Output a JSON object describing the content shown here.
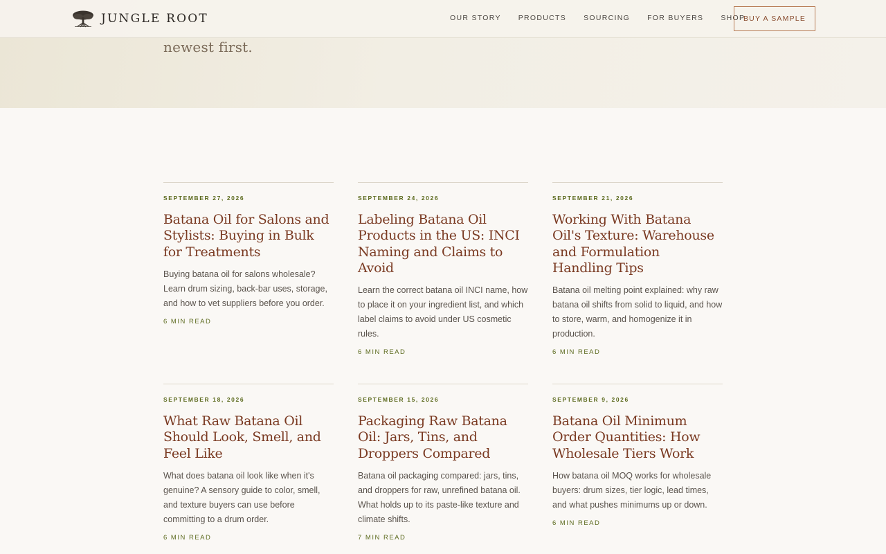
{
  "header": {
    "logo_text": "JUNGLE ROOT",
    "nav": [
      "OUR STORY",
      "PRODUCTS",
      "SOURCING",
      "FOR BUYERS",
      "SHOP"
    ],
    "cta": "BUY A SAMPLE"
  },
  "hero": {
    "text": "newest first."
  },
  "colors": {
    "accent": "#7a3a22",
    "date": "#5c6a1e",
    "button_border": "#b87c55"
  },
  "articles": [
    {
      "date": "SEPTEMBER 27, 2026",
      "title": "Batana Oil for Salons and Stylists: Buying in Bulk for Treatments",
      "desc": "Buying batana oil for salons wholesale? Learn drum sizing, back-bar uses, storage, and how to vet suppliers before you order.",
      "read": "6 MIN READ"
    },
    {
      "date": "SEPTEMBER 24, 2026",
      "title": "Labeling Batana Oil Products in the US: INCI Naming and Claims to Avoid",
      "desc": "Learn the correct batana oil INCI name, how to place it on your ingredient list, and which label claims to avoid under US cosmetic rules.",
      "read": "6 MIN READ"
    },
    {
      "date": "SEPTEMBER 21, 2026",
      "title": "Working With Batana Oil's Texture: Warehouse and Formulation Handling Tips",
      "desc": "Batana oil melting point explained: why raw batana oil shifts from solid to liquid, and how to store, warm, and homogenize it in production.",
      "read": "6 MIN READ"
    },
    {
      "date": "SEPTEMBER 18, 2026",
      "title": "What Raw Batana Oil Should Look, Smell, and Feel Like",
      "desc": "What does batana oil look like when it's genuine? A sensory guide to color, smell, and texture buyers can use before committing to a drum order.",
      "read": "6 MIN READ"
    },
    {
      "date": "SEPTEMBER 15, 2026",
      "title": "Packaging Raw Batana Oil: Jars, Tins, and Droppers Compared",
      "desc": "Batana oil packaging compared: jars, tins, and droppers for raw, unrefined batana oil. What holds up to its paste-like texture and climate shifts.",
      "read": "7 MIN READ"
    },
    {
      "date": "SEPTEMBER 9, 2026",
      "title": "Batana Oil Minimum Order Quantities: How Wholesale Tiers Work",
      "desc": "How batana oil MOQ works for wholesale buyers: drum sizes, tier logic, lead times, and what pushes minimums up or down.",
      "read": "6 MIN READ"
    }
  ]
}
